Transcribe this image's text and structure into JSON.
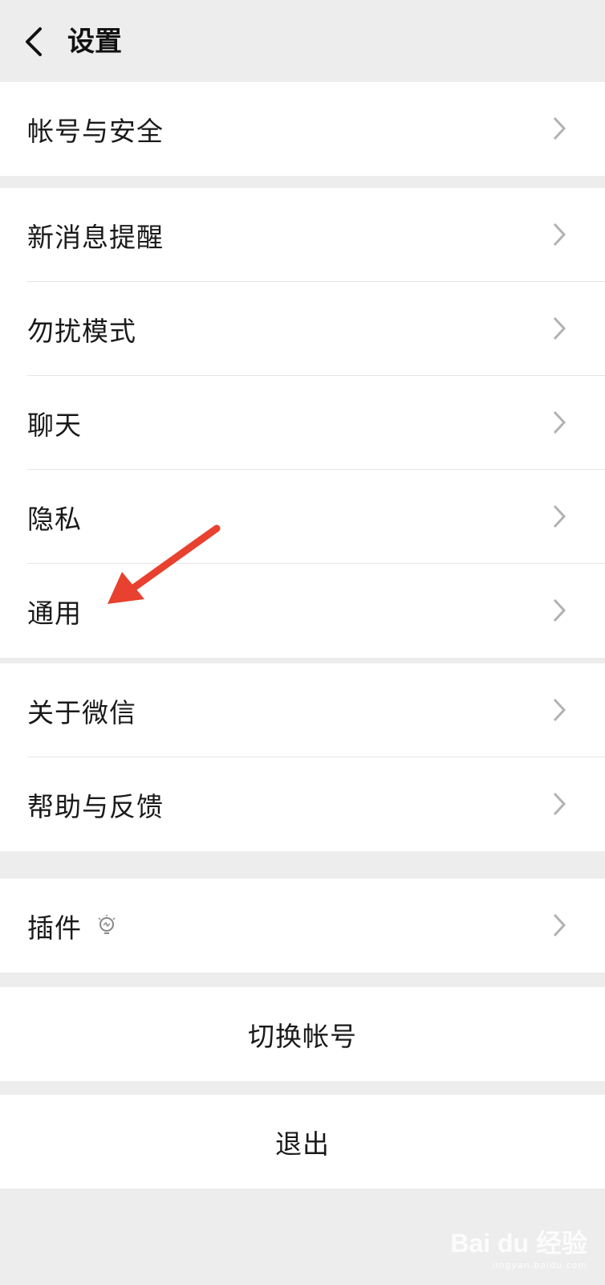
{
  "header": {
    "title": "设置"
  },
  "groups": {
    "g1": [
      {
        "label": "帐号与安全"
      }
    ],
    "g2": [
      {
        "label": "新消息提醒"
      },
      {
        "label": "勿扰模式"
      },
      {
        "label": "聊天"
      },
      {
        "label": "隐私"
      },
      {
        "label": "通用"
      }
    ],
    "g3": [
      {
        "label": "关于微信"
      },
      {
        "label": "帮助与反馈"
      }
    ],
    "g4": [
      {
        "label": "插件"
      }
    ]
  },
  "actions": {
    "switch_account": "切换帐号",
    "logout": "退出"
  },
  "watermark": {
    "main": "Bai du 经验",
    "sub": "jingyan.baidu.com"
  },
  "colors": {
    "background": "#ededed",
    "card": "#ffffff",
    "annotation_arrow": "#e8412f"
  }
}
